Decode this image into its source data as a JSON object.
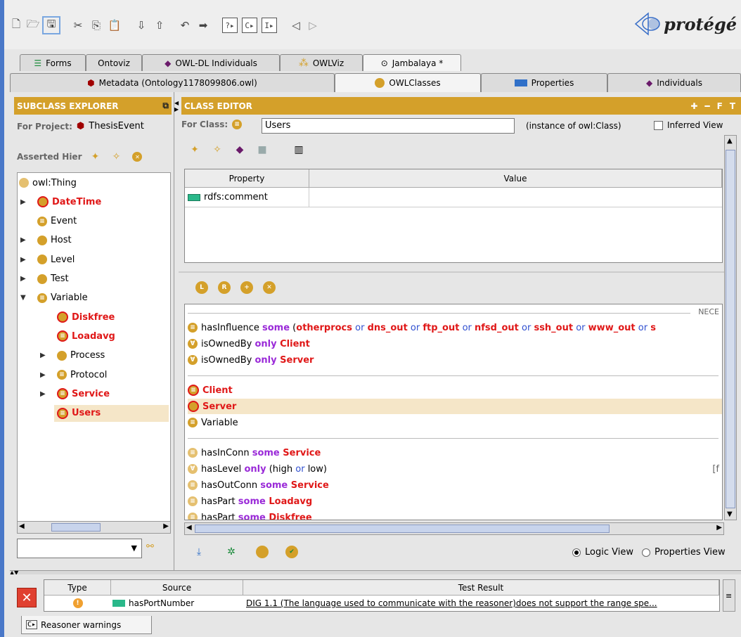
{
  "app": {
    "logo_text": "protégé"
  },
  "toolbar": {
    "buttons": [
      "new-file-icon",
      "open-file-icon",
      "save-icon",
      "cut-icon",
      "copy-icon",
      "paste-icon",
      "import-icon",
      "export-icon",
      "undo-icon",
      "redo-icon",
      "help-icon",
      "forward-icon",
      "step-icon",
      "back-arrow-icon",
      "forward-arrow-icon"
    ],
    "help_glyph": "?▸",
    "step1_glyph": "C▸",
    "step2_glyph": "I▸"
  },
  "tabs_row1": [
    {
      "label": "Forms",
      "icon": "forms-icon"
    },
    {
      "label": "Ontoviz",
      "icon": ""
    },
    {
      "label": "OWL-DL Individuals",
      "icon": "individual-icon"
    },
    {
      "label": "OWLViz",
      "icon": "owlviz-icon"
    },
    {
      "label": "Jambalaya *",
      "icon": "jambalaya-icon"
    }
  ],
  "tabs_row2": [
    {
      "label": "Metadata (Ontology1178099806.owl)",
      "icon": "metadata-icon"
    },
    {
      "label": "OWLClasses",
      "icon": "class-icon"
    },
    {
      "label": "Properties",
      "icon": "property-icon"
    },
    {
      "label": "Individuals",
      "icon": "individual-icon"
    }
  ],
  "subclass_explorer": {
    "header": "SUBCLASS EXPLORER",
    "project_label": "For Project:",
    "project_name": "ThesisEvent",
    "hierarchy_label": "Asserted Hier",
    "tree": [
      {
        "label": "owl:Thing",
        "indent": 0,
        "expander": "",
        "icon": "thing",
        "style": "normal"
      },
      {
        "label": "DateTime",
        "indent": 1,
        "expander": "collapsed",
        "icon": "red",
        "style": "red"
      },
      {
        "label": "Event",
        "indent": 1,
        "expander": "",
        "icon": "def",
        "style": "normal"
      },
      {
        "label": "Host",
        "indent": 1,
        "expander": "collapsed",
        "icon": "gold",
        "style": "normal"
      },
      {
        "label": "Level",
        "indent": 1,
        "expander": "collapsed",
        "icon": "gold",
        "style": "normal"
      },
      {
        "label": "Test",
        "indent": 1,
        "expander": "collapsed",
        "icon": "gold",
        "style": "normal"
      },
      {
        "label": "Variable",
        "indent": 1,
        "expander": "expanded",
        "icon": "def",
        "style": "normal"
      },
      {
        "label": "Diskfree",
        "indent": 2,
        "expander": "",
        "icon": "red",
        "style": "red"
      },
      {
        "label": "Loadavg",
        "indent": 2,
        "expander": "",
        "icon": "red-def",
        "style": "red"
      },
      {
        "label": "Process",
        "indent": 2,
        "expander": "collapsed",
        "icon": "gold",
        "style": "normal"
      },
      {
        "label": "Protocol",
        "indent": 2,
        "expander": "collapsed",
        "icon": "def",
        "style": "normal"
      },
      {
        "label": "Service",
        "indent": 2,
        "expander": "collapsed",
        "icon": "red-def",
        "style": "red"
      },
      {
        "label": "Users",
        "indent": 2,
        "expander": "",
        "icon": "red-def",
        "style": "red",
        "selected": true
      }
    ]
  },
  "class_editor": {
    "header": "CLASS EDITOR",
    "for_class_label": "For Class:",
    "class_name": "Users",
    "instance_of": "(instance of owl:Class)",
    "inferred_view_label": "Inferred View",
    "header_buttons": [
      "✚",
      "━",
      "F",
      "T"
    ],
    "table_headers": {
      "property": "Property",
      "value": "Value"
    },
    "annotations": [
      {
        "property": "rdfs:comment",
        "value": ""
      }
    ],
    "necessary_label": "NECE",
    "conditions_group1": [
      {
        "icon": "def",
        "parts": [
          {
            "t": "hasInfluence ",
            "s": "normal"
          },
          {
            "t": "some",
            "s": "purple"
          },
          {
            "t": " (",
            "s": "normal"
          },
          {
            "t": "otherprocs",
            "s": "red"
          },
          {
            "t": " or ",
            "s": "blue"
          },
          {
            "t": "dns_out",
            "s": "red"
          },
          {
            "t": " or ",
            "s": "blue"
          },
          {
            "t": "ftp_out",
            "s": "red"
          },
          {
            "t": " or ",
            "s": "blue"
          },
          {
            "t": "nfsd_out",
            "s": "red"
          },
          {
            "t": " or ",
            "s": "blue"
          },
          {
            "t": "ssh_out",
            "s": "red"
          },
          {
            "t": " or ",
            "s": "blue"
          },
          {
            "t": "www_out",
            "s": "red"
          },
          {
            "t": " or ",
            "s": "blue"
          },
          {
            "t": "s",
            "s": "red"
          }
        ]
      },
      {
        "icon": "forall",
        "parts": [
          {
            "t": "isOwnedBy ",
            "s": "normal"
          },
          {
            "t": "only",
            "s": "purple"
          },
          {
            "t": " Client",
            "s": "red"
          }
        ]
      },
      {
        "icon": "forall",
        "parts": [
          {
            "t": "isOwnedBy ",
            "s": "normal"
          },
          {
            "t": "only",
            "s": "purple"
          },
          {
            "t": " Server",
            "s": "red"
          }
        ]
      }
    ],
    "conditions_group2": [
      {
        "icon": "red-def",
        "parts": [
          {
            "t": "Client",
            "s": "red"
          }
        ]
      },
      {
        "icon": "red",
        "parts": [
          {
            "t": "Server",
            "s": "red"
          }
        ],
        "selected": true
      },
      {
        "icon": "def",
        "parts": [
          {
            "t": "Variable",
            "s": "normal"
          }
        ]
      }
    ],
    "conditions_group3": [
      {
        "icon": "def-light",
        "parts": [
          {
            "t": "hasInConn ",
            "s": "normal"
          },
          {
            "t": "some",
            "s": "purple"
          },
          {
            "t": " Service",
            "s": "red"
          }
        ]
      },
      {
        "icon": "forall-light",
        "parts": [
          {
            "t": "hasLevel ",
            "s": "normal"
          },
          {
            "t": "only",
            "s": "purple"
          },
          {
            "t": " (high ",
            "s": "normal"
          },
          {
            "t": "or",
            "s": "blue"
          },
          {
            "t": " low)",
            "s": "normal"
          }
        ],
        "suffix": "[f"
      },
      {
        "icon": "def-light",
        "parts": [
          {
            "t": "hasOutConn ",
            "s": "normal"
          },
          {
            "t": "some",
            "s": "purple"
          },
          {
            "t": " Service",
            "s": "red"
          }
        ]
      },
      {
        "icon": "def-light",
        "parts": [
          {
            "t": "hasPart ",
            "s": "normal"
          },
          {
            "t": "some",
            "s": "purple"
          },
          {
            "t": " Loadavg",
            "s": "red"
          }
        ]
      },
      {
        "icon": "def-light",
        "parts": [
          {
            "t": "hasPart ",
            "s": "normal"
          },
          {
            "t": "some",
            "s": "purple"
          },
          {
            "t": " Diskfree",
            "s": "red"
          }
        ]
      }
    ],
    "view_options": {
      "logic": "Logic View",
      "properties": "Properties View",
      "selected": "logic"
    }
  },
  "warnings": {
    "headers": {
      "type": "Type",
      "source": "Source",
      "result": "Test Result"
    },
    "rows": [
      {
        "type_icon": "warning-icon",
        "source": "hasPortNumber",
        "result": "DIG 1.1 (The language used to communicate with the reasoner)does not support the range spe..."
      }
    ],
    "tab_label": "Reasoner warnings",
    "tab_icon": "C▸"
  },
  "colors": {
    "accent": "#d4a02a",
    "red_class": "#e01818",
    "purple_keyword": "#9a2ad8",
    "blue_keyword": "#3050d0"
  }
}
